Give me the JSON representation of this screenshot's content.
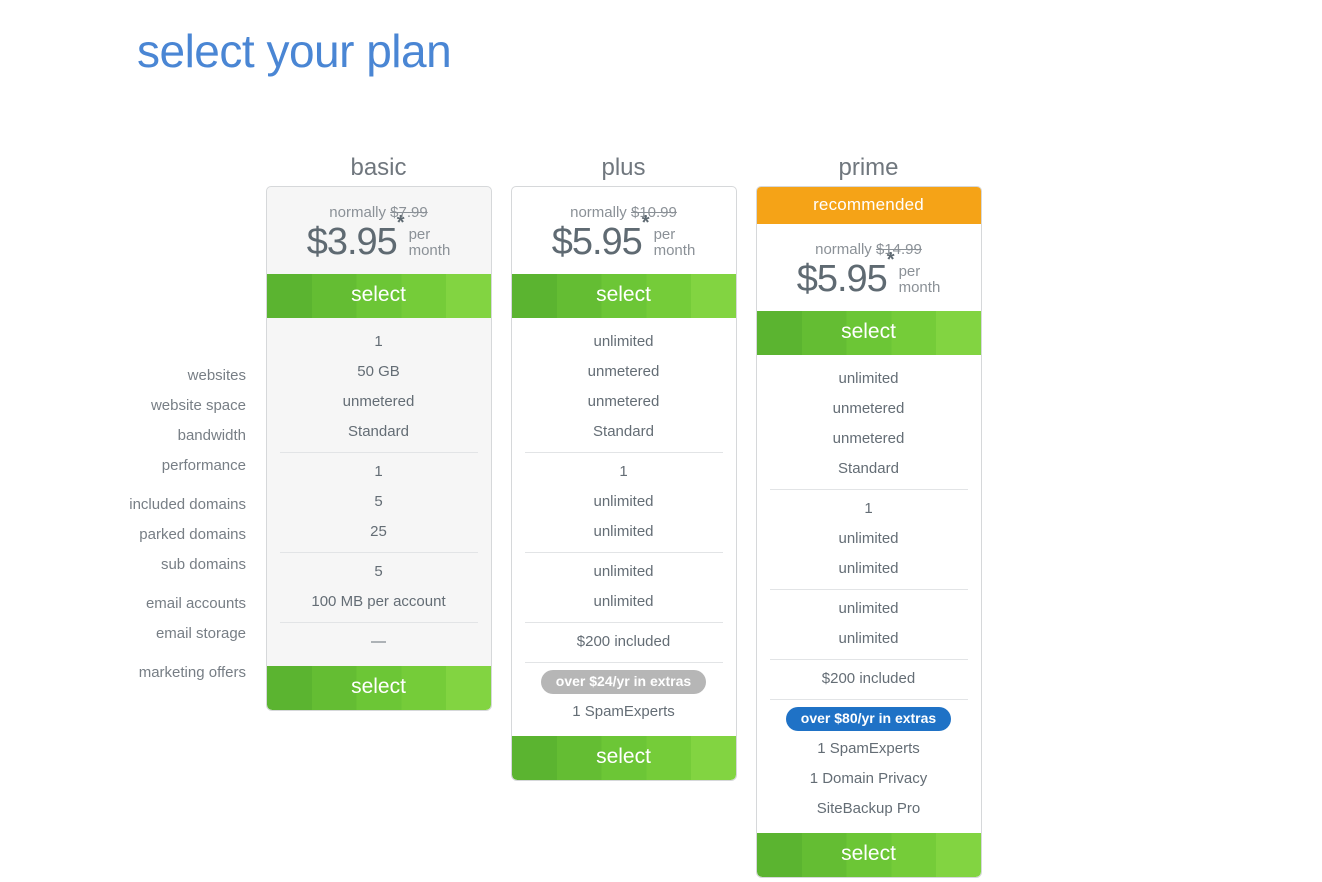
{
  "page": {
    "title": "select your plan"
  },
  "feature_labels": [
    {
      "label": "websites"
    },
    {
      "label": "website space"
    },
    {
      "label": "bandwidth"
    },
    {
      "label": "performance"
    },
    {
      "label": "included domains"
    },
    {
      "label": "parked domains"
    },
    {
      "label": "sub domains"
    },
    {
      "label": "email accounts"
    },
    {
      "label": "email storage"
    },
    {
      "label": "marketing offers"
    }
  ],
  "select_label": "select",
  "plans": {
    "basic": {
      "name": "basic",
      "recommended_badge": null,
      "normally_prefix": "normally",
      "normally_price": "$7.99",
      "price": "$3.95",
      "asterisk": "*",
      "per": "per",
      "month": "month",
      "select_label": "select",
      "features": {
        "websites": "1",
        "website_space": "50 GB",
        "bandwidth": "unmetered",
        "performance": "Standard",
        "included_domains": "1",
        "parked_domains": "5",
        "sub_domains": "25",
        "email_accounts": "5",
        "email_storage": "100 MB per account",
        "marketing_offers": "—"
      },
      "extras_pill": null,
      "extras_items": []
    },
    "plus": {
      "name": "plus",
      "recommended_badge": null,
      "normally_prefix": "normally",
      "normally_price": "$10.99",
      "price": "$5.95",
      "asterisk": "*",
      "per": "per",
      "month": "month",
      "select_label": "select",
      "features": {
        "websites": "unlimited",
        "website_space": "unmetered",
        "bandwidth": "unmetered",
        "performance": "Standard",
        "included_domains": "1",
        "parked_domains": "unlimited",
        "sub_domains": "unlimited",
        "email_accounts": "unlimited",
        "email_storage": "unlimited",
        "marketing_offers": "$200 included"
      },
      "extras_pill": "over $24/yr in extras",
      "extras_items": [
        "1 SpamExperts"
      ]
    },
    "prime": {
      "name": "prime",
      "recommended_badge": "recommended",
      "normally_prefix": "normally",
      "normally_price": "$14.99",
      "price": "$5.95",
      "asterisk": "*",
      "per": "per",
      "month": "month",
      "select_label": "select",
      "features": {
        "websites": "unlimited",
        "website_space": "unmetered",
        "bandwidth": "unmetered",
        "performance": "Standard",
        "included_domains": "1",
        "parked_domains": "unlimited",
        "sub_domains": "unlimited",
        "email_accounts": "unlimited",
        "email_storage": "unlimited",
        "marketing_offers": "$200 included"
      },
      "extras_pill": "over $80/yr in extras",
      "extras_items": [
        "1 SpamExperts",
        "1 Domain Privacy",
        "SiteBackup Pro"
      ]
    }
  },
  "colors": {
    "title_blue": "#4a86d4",
    "select_green": "#6cc636",
    "recommended_orange": "#f5a317",
    "pill_gray": "#b6b6b6",
    "pill_blue": "#1f72c6",
    "text_gray": "#646d75"
  }
}
